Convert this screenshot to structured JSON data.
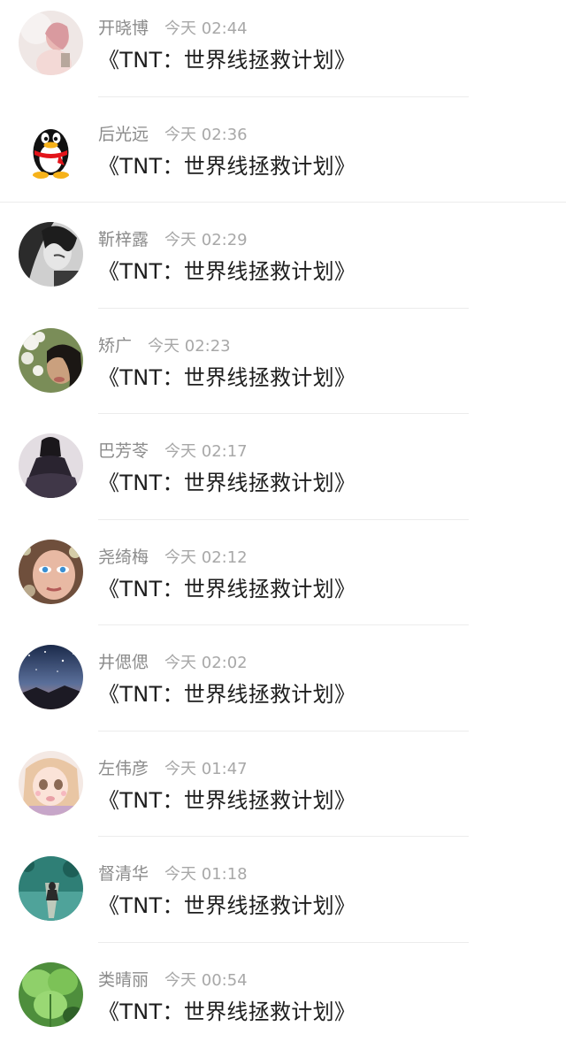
{
  "messages": [
    {
      "name": "开晓博",
      "time": "今天 02:44",
      "title": "《TNT：世界线拯救计划》",
      "avatar_icon": "pink-girl-avatar-icon"
    },
    {
      "name": "后光远",
      "time": "今天 02:36",
      "title": "《TNT：世界线拯救计划》",
      "avatar_icon": "qq-penguin-avatar-icon"
    },
    {
      "name": "靳梓露",
      "time": "今天 02:29",
      "title": "《TNT：世界线拯救计划》",
      "avatar_icon": "monochrome-girl-avatar-icon"
    },
    {
      "name": "矫广",
      "time": "今天 02:23",
      "title": "《TNT：世界线拯救计划》",
      "avatar_icon": "flower-girl-avatar-icon"
    },
    {
      "name": "巴芳苓",
      "time": "今天 02:17",
      "title": "《TNT：世界线拯救计划》",
      "avatar_icon": "dark-dress-avatar-icon"
    },
    {
      "name": "尧绮梅",
      "time": "今天 02:12",
      "title": "《TNT：世界线拯救计划》",
      "avatar_icon": "blue-eye-face-avatar-icon"
    },
    {
      "name": "井偲偲",
      "time": "今天 02:02",
      "title": "《TNT：世界线拯救计划》",
      "avatar_icon": "starry-sky-avatar-icon"
    },
    {
      "name": "左伟彦",
      "time": "今天 01:47",
      "title": "《TNT：世界线拯救计划》",
      "avatar_icon": "anime-girl-avatar-icon"
    },
    {
      "name": "督清华",
      "time": "今天 01:18",
      "title": "《TNT：世界线拯救计划》",
      "avatar_icon": "teal-water-avatar-icon"
    },
    {
      "name": "类晴丽",
      "time": "今天 00:54",
      "title": "《TNT：世界线拯救计划》",
      "avatar_icon": "clover-leaf-avatar-icon"
    }
  ],
  "colors": {
    "name_text": "#8b8b8b",
    "time_text": "#a8a8a8",
    "title_text": "#1e1e1e",
    "divider": "#ececec"
  }
}
